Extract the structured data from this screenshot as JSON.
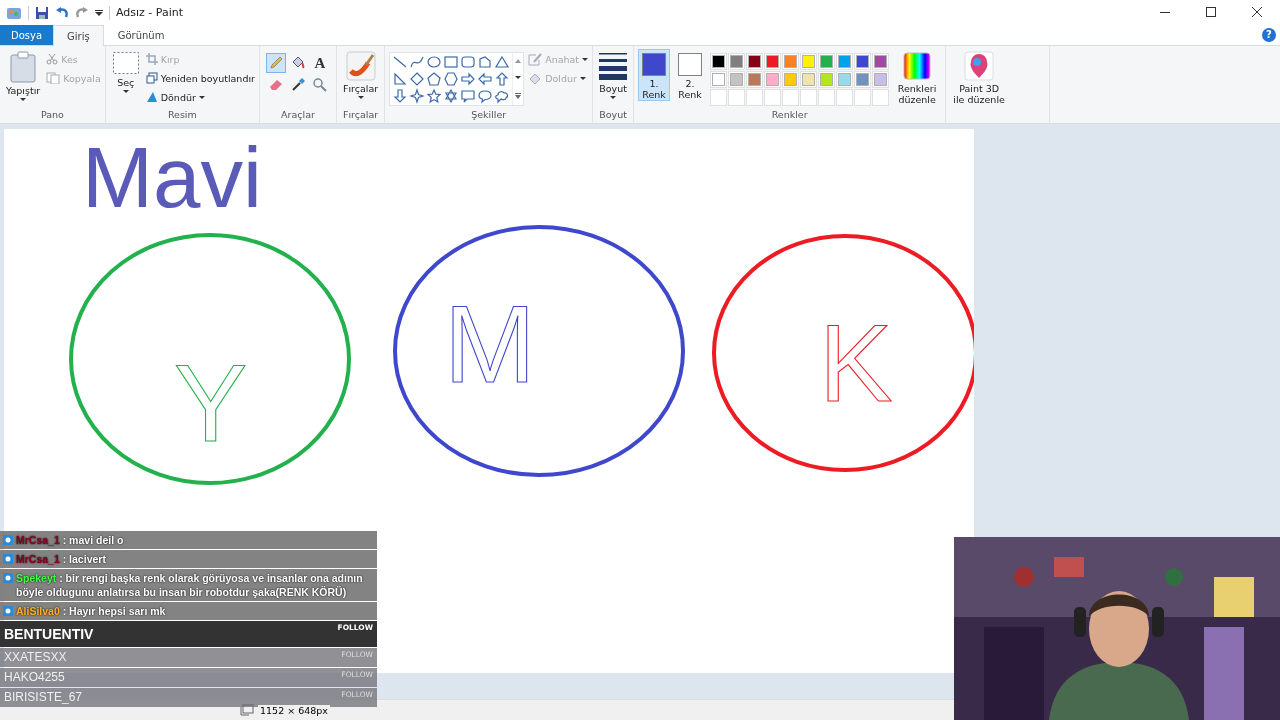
{
  "window": {
    "title": "Adsız - Paint",
    "help": "?"
  },
  "menu_tabs": [
    {
      "label": "Dosya",
      "kind": "file",
      "selected": false
    },
    {
      "label": "Giriş",
      "kind": "tab",
      "selected": true
    },
    {
      "label": "Görünüm",
      "kind": "tab",
      "selected": false
    }
  ],
  "ribbon": {
    "clipboard": {
      "label": "Pano",
      "paste": "Yapıştır",
      "cut": {
        "label": "Kes",
        "disabled": true
      },
      "copy": {
        "label": "Kopyala",
        "disabled": true
      }
    },
    "image": {
      "label": "Resim",
      "select": "Seç",
      "crop": {
        "label": "Kırp",
        "disabled": true
      },
      "resize": {
        "label": "Yeniden boyutlandır",
        "disabled": false
      },
      "rotate": {
        "label": "Döndür",
        "disabled": false
      }
    },
    "tools": {
      "label": "Araçlar",
      "items": [
        {
          "kind": "pencil",
          "selected": true
        },
        {
          "kind": "fill",
          "selected": false
        },
        {
          "kind": "text",
          "glyph": "A",
          "selected": false
        },
        {
          "kind": "eraser",
          "selected": false
        },
        {
          "kind": "picker",
          "selected": false
        },
        {
          "kind": "magnifier",
          "selected": false
        }
      ]
    },
    "brushes": {
      "label": "Fırçalar",
      "button": "Fırçalar"
    },
    "shapes": {
      "label": "Şekiller",
      "outline": {
        "label": "Anahat",
        "disabled": true
      },
      "fill": {
        "label": "Doldur",
        "disabled": true
      }
    },
    "size": {
      "label": "Boyut",
      "button": "Boyut"
    },
    "colors": {
      "label": "Renkler",
      "color1": {
        "label": "1. Renk",
        "color": "#3f48cc",
        "selected": true
      },
      "color2": {
        "label": "2. Renk",
        "color": "#ffffff",
        "selected": false
      },
      "palette": [
        {
          "color": "#000000"
        },
        {
          "color": "#7f7f7f"
        },
        {
          "color": "#880015"
        },
        {
          "color": "#ed1c24"
        },
        {
          "color": "#ff7f27"
        },
        {
          "color": "#fff200"
        },
        {
          "color": "#22b14c"
        },
        {
          "color": "#00a2e8"
        },
        {
          "color": "#3f48cc"
        },
        {
          "color": "#a349a4"
        },
        {
          "color": "#ffffff"
        },
        {
          "color": "#c3c3c3"
        },
        {
          "color": "#b97a57"
        },
        {
          "color": "#ffaec9"
        },
        {
          "color": "#ffc90e"
        },
        {
          "color": "#efe4b0"
        },
        {
          "color": "#b5e61d"
        },
        {
          "color": "#99d9ea"
        },
        {
          "color": "#7092be"
        },
        {
          "color": "#c8bfe7"
        }
      ],
      "edit": "Renkleri düzenle"
    },
    "paint3d": {
      "label": "Paint 3D ile düzenle"
    }
  },
  "canvas": {
    "heading": {
      "text": "Mavi",
      "color": "#5a5ab8"
    },
    "figures": [
      {
        "kind": "ellipse",
        "color": "#22b14c",
        "letter": "Y"
      },
      {
        "kind": "ellipse",
        "color": "#3f48cc",
        "letter": "M"
      },
      {
        "kind": "ellipse",
        "color": "#ed1c24",
        "letter": "K"
      }
    ]
  },
  "status_bar": {
    "size": "1152 × 648px"
  },
  "chat": {
    "messages": [
      {
        "user": "MrCsa_1",
        "color": "#8a0020",
        "text": ": mavi deil o"
      },
      {
        "user": "MrCsa_1",
        "color": "#8a0020",
        "text": ": lacivert"
      },
      {
        "user": "Spekeyt",
        "color": "#40ff40",
        "text": ": bir rengi başka renk olarak görüyosa ve insanlar ona adının böyle oldugunu anlatırsa bu insan bir robotdur şaka(RENK KÖRÜ)"
      },
      {
        "user": "AliSilva0",
        "color": "#ffb020",
        "text": ": Hayır hepsi sarı mk"
      }
    ],
    "followers": [
      {
        "name": "BENTUENTIV",
        "action": "FOLLOW",
        "highlighted": true
      },
      {
        "name": "XXATESXX",
        "action": "FOLLOW",
        "highlighted": false
      },
      {
        "name": "HAKO4255",
        "action": "FOLLOW",
        "highlighted": false
      },
      {
        "name": "BIRISISTE_67",
        "action": "FOLLOW",
        "highlighted": false
      }
    ]
  }
}
